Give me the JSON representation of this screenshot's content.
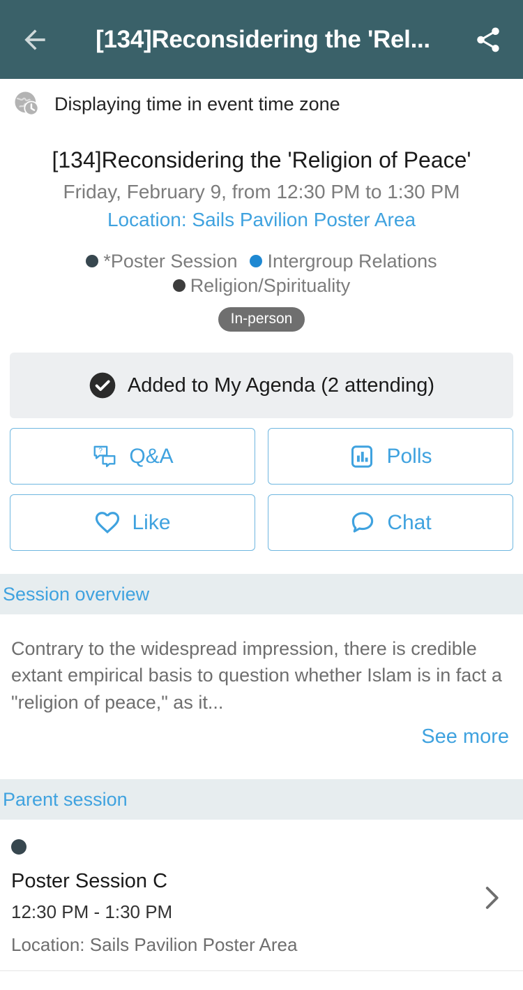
{
  "appbar": {
    "back_icon": "arrow-left-icon",
    "title": "[134]Reconsidering the 'Rel...",
    "share_icon": "share-icon",
    "background_color": "#3A6169"
  },
  "timezone_bar": {
    "icon": "globe-clock-icon",
    "text": "Displaying time in event time zone"
  },
  "session": {
    "title": "[134]Reconsidering the 'Religion of Peace'",
    "time": "Friday, February 9, from 12:30 PM to 1:30 PM",
    "location": "Location: Sails Pavilion Poster Area",
    "tracks": [
      {
        "label": "*Poster Session",
        "color": "#37474F"
      },
      {
        "label": "Intergroup Relations",
        "color": "#1E88D2"
      },
      {
        "label": "Religion/Spirituality",
        "color": "#3D3D3D"
      }
    ],
    "format_badge": "In-person",
    "badge_color": "#6F6F6F"
  },
  "agenda": {
    "icon": "check-circle-icon",
    "label": "Added to My Agenda (2 attending)"
  },
  "actions": [
    {
      "label": "Q&A",
      "icon": "question-bubbles-icon"
    },
    {
      "label": "Polls",
      "icon": "bar-chart-box-icon"
    },
    {
      "label": "Like",
      "icon": "heart-icon"
    },
    {
      "label": "Chat",
      "icon": "chat-bubble-icon"
    }
  ],
  "overview": {
    "header": "Session overview",
    "text": "Contrary to the widespread impression, there is credible extant empirical basis to question whether Islam is in fact a \"religion of peace,\" as it...",
    "see_more": "See more"
  },
  "parent_session": {
    "header": "Parent session",
    "dot_color": "#37474F",
    "title": "Poster Session C",
    "time": "12:30 PM - 1:30 PM",
    "location": "Location: Sails Pavilion Poster Area",
    "chevron_icon": "chevron-right-icon"
  },
  "theme": {
    "accent_blue": "#3FA2DF",
    "header_teal": "#3A6169",
    "section_bg": "#E7EDEF"
  }
}
